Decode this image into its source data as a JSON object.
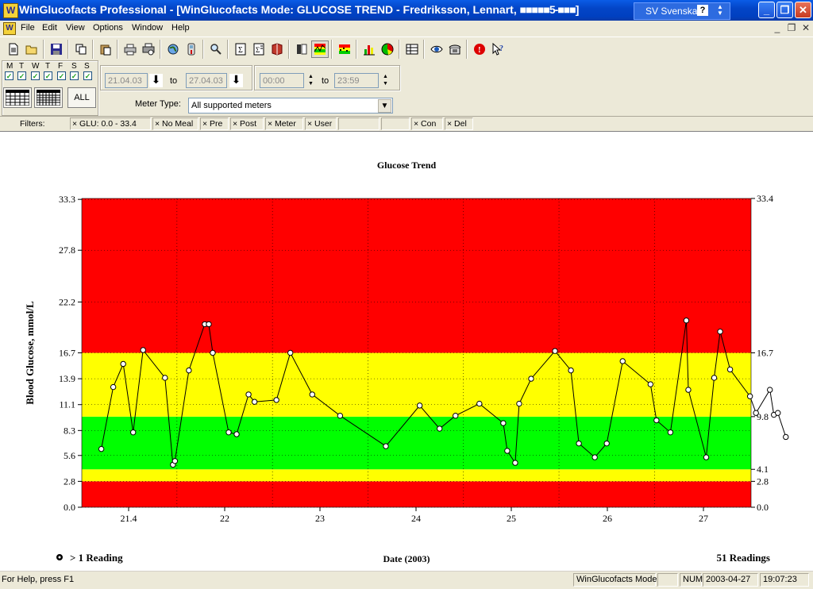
{
  "window": {
    "title": "WinGlucofacts Professional - [WinGlucofacts Mode: GLUCOSE TREND - Fredriksson, Lennart, ",
    "title_redacted": "■■■■■5-■■■]",
    "language": "SV Svenska",
    "help_btn": "?"
  },
  "menu": [
    "File",
    "Edit",
    "View",
    "Options",
    "Window",
    "Help"
  ],
  "toolbar_icons": [
    "new-icon",
    "open-icon",
    "save-icon",
    "copy-icon",
    "paste-icon",
    "print-icon",
    "print-preview-icon",
    "globe-icon",
    "meter-icon",
    "find-icon",
    "sum-icon",
    "sum-report-icon",
    "book-icon",
    "logbook-icon",
    "trend-icon",
    "standard-day-icon",
    "bar-chart-icon",
    "pie-chart-icon",
    "table-icon",
    "eye-icon",
    "phone-icon",
    "info-icon",
    "context-help-icon"
  ],
  "days": [
    "M",
    "T",
    "W",
    "T",
    "F",
    "S",
    "S"
  ],
  "date_from": "21.04.03",
  "date_to": "27.04.03",
  "to_label": "to",
  "time_from": "00:00",
  "time_to": "23:59",
  "all_button": "ALL",
  "meter_type_label": "Meter Type:",
  "meter_type_value": "All supported meters",
  "filters": {
    "label": "Filters:",
    "items": [
      "× GLU:  0.0 - 33.4",
      "× No Meal",
      "× Pre",
      "× Post",
      "× Meter",
      "× User",
      "",
      "",
      "× Con",
      "× Del"
    ]
  },
  "colors": {
    "red": "#ff0000",
    "yellow": "#ffff00",
    "green": "#00ff00"
  },
  "chart_data": {
    "type": "line",
    "title": "Glucose Trend",
    "ylabel": "Blood Glucose, mmol/L",
    "xlabel": "Date (2003)",
    "ylim": [
      0,
      33.4
    ],
    "left_ticks": [
      "0.0",
      "2.8",
      "5.6",
      "8.3",
      "11.1",
      "13.9",
      "16.7",
      "22.2",
      "27.8",
      "33.3"
    ],
    "right_ticks": [
      "0.0",
      "2.8",
      "4.1",
      "9.8",
      "16.7",
      "33.4"
    ],
    "x_ticks": [
      "21.4",
      "22",
      "23",
      "24",
      "25",
      "26",
      "27"
    ],
    "bands": [
      {
        "from": 0,
        "to": 2.8,
        "color": "red"
      },
      {
        "from": 2.8,
        "to": 4.1,
        "color": "yellow"
      },
      {
        "from": 4.1,
        "to": 9.8,
        "color": "green"
      },
      {
        "from": 9.8,
        "to": 16.7,
        "color": "yellow"
      },
      {
        "from": 16.7,
        "to": 33.4,
        "color": "red"
      }
    ],
    "legend_text": "> 1 Reading",
    "readings_text": "51 Readings",
    "x_start": "2003-04-21",
    "series": [
      {
        "points": [
          {
            "x": "2003-04-20T17:00",
            "y": 6.3
          },
          {
            "x": "2003-04-20T20:00",
            "y": 13.0
          },
          {
            "x": "2003-04-20T22:30",
            "y": 15.5
          },
          {
            "x": "2003-04-21T01:00",
            "y": 8.1
          },
          {
            "x": "2003-04-21T03:30",
            "y": 17.0
          },
          {
            "x": "2003-04-21T09:00",
            "y": 14.0
          },
          {
            "x": "2003-04-21T11:00",
            "y": 4.6
          },
          {
            "x": "2003-04-21T11:30",
            "y": 5.0
          },
          {
            "x": "2003-04-21T15:00",
            "y": 14.8
          },
          {
            "x": "2003-04-21T19:00",
            "y": 19.8
          },
          {
            "x": "2003-04-21T20:00",
            "y": 19.8
          },
          {
            "x": "2003-04-21T21:00",
            "y": 16.7
          },
          {
            "x": "2003-04-22T01:00",
            "y": 8.1
          },
          {
            "x": "2003-04-22T03:00",
            "y": 7.9
          },
          {
            "x": "2003-04-22T06:00",
            "y": 12.2
          },
          {
            "x": "2003-04-22T07:30",
            "y": 11.4
          },
          {
            "x": "2003-04-22T13:00",
            "y": 11.6
          },
          {
            "x": "2003-04-22T16:30",
            "y": 16.7
          },
          {
            "x": "2003-04-22T22:00",
            "y": 12.2
          },
          {
            "x": "2003-04-23T05:00",
            "y": 9.9
          },
          {
            "x": "2003-04-23T16:30",
            "y": 6.6
          },
          {
            "x": "2003-04-24T01:00",
            "y": 11.0
          },
          {
            "x": "2003-04-24T06:00",
            "y": 8.5
          },
          {
            "x": "2003-04-24T10:00",
            "y": 9.9
          },
          {
            "x": "2003-04-24T16:00",
            "y": 11.2
          },
          {
            "x": "2003-04-24T22:00",
            "y": 9.1
          },
          {
            "x": "2003-04-24T23:00",
            "y": 6.1
          },
          {
            "x": "2003-04-25T01:00",
            "y": 4.8
          },
          {
            "x": "2003-04-25T02:00",
            "y": 11.2
          },
          {
            "x": "2003-04-25T05:00",
            "y": 13.9
          },
          {
            "x": "2003-04-25T11:00",
            "y": 16.9
          },
          {
            "x": "2003-04-25T15:00",
            "y": 14.8
          },
          {
            "x": "2003-04-25T17:00",
            "y": 6.9
          },
          {
            "x": "2003-04-25T21:00",
            "y": 5.4
          },
          {
            "x": "2003-04-26T00:00",
            "y": 6.9
          },
          {
            "x": "2003-04-26T04:00",
            "y": 15.8
          },
          {
            "x": "2003-04-26T11:00",
            "y": 13.3
          },
          {
            "x": "2003-04-26T12:30",
            "y": 9.4
          },
          {
            "x": "2003-04-26T16:00",
            "y": 8.1
          },
          {
            "x": "2003-04-26T20:00",
            "y": 20.2
          },
          {
            "x": "2003-04-26T20:30",
            "y": 12.7
          },
          {
            "x": "2003-04-27T01:00",
            "y": 5.4
          },
          {
            "x": "2003-04-27T03:00",
            "y": 14.0
          },
          {
            "x": "2003-04-27T04:30",
            "y": 19.0
          },
          {
            "x": "2003-04-27T07:00",
            "y": 14.9
          },
          {
            "x": "2003-04-27T12:00",
            "y": 12.0
          },
          {
            "x": "2003-04-27T13:30",
            "y": 10.2
          },
          {
            "x": "2003-04-27T17:00",
            "y": 12.7
          },
          {
            "x": "2003-04-27T18:00",
            "y": 10.0
          },
          {
            "x": "2003-04-27T19:00",
            "y": 10.2
          },
          {
            "x": "2003-04-27T21:00",
            "y": 7.6
          }
        ]
      }
    ]
  },
  "status": {
    "help": "For Help, press F1",
    "mode": "WinGlucofacts Mode",
    "num": "NUM",
    "date": "2003-04-27",
    "time": "19:07:23"
  }
}
